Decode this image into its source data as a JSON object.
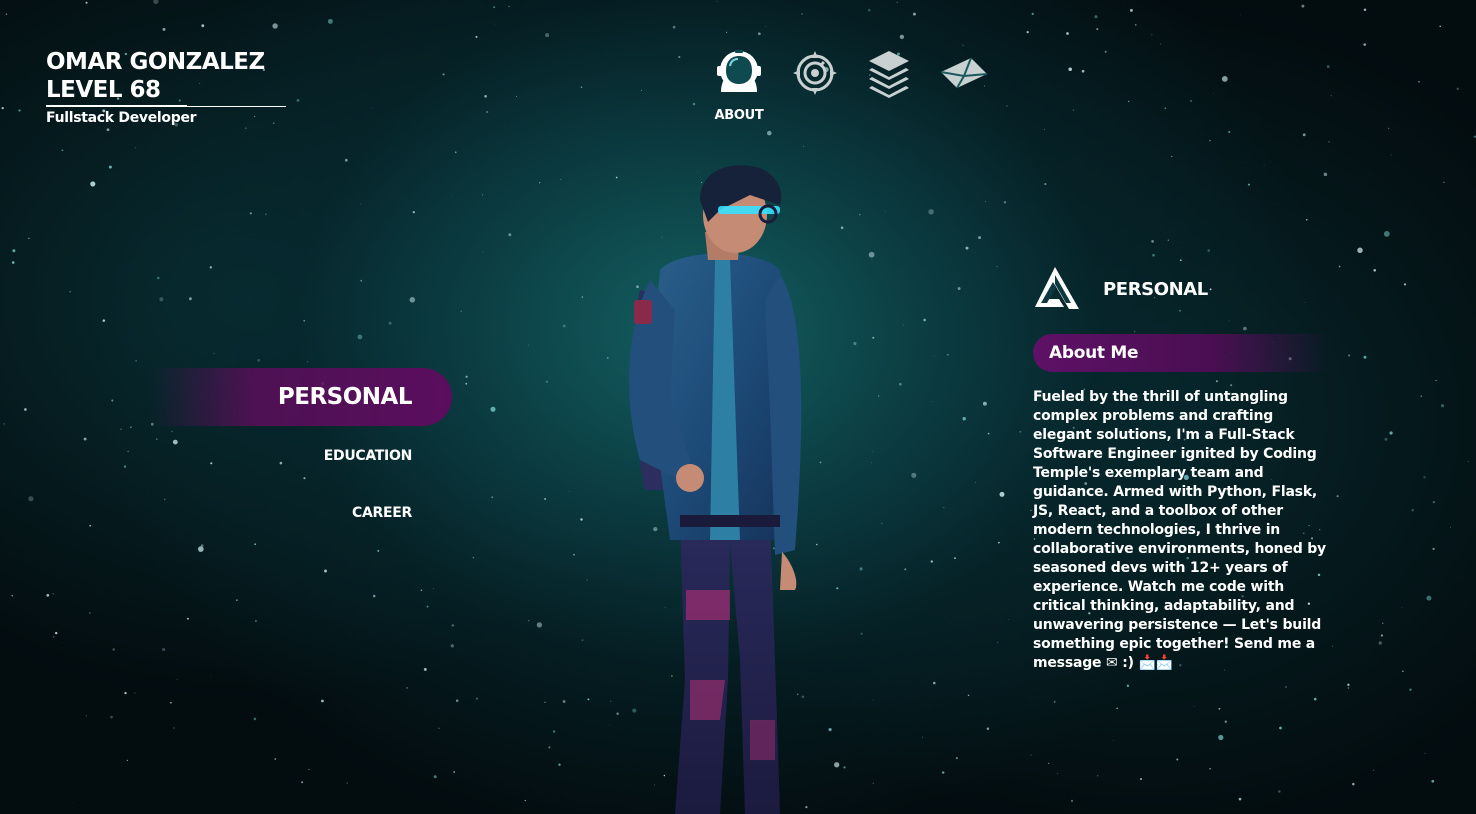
{
  "player": {
    "name": "OMAR GONZALEZ",
    "level": "LEVEL 68",
    "title": "Fullstack Developer"
  },
  "top_nav": {
    "items": [
      {
        "icon": "astronaut-helmet-icon",
        "label": "ABOUT",
        "active": true
      },
      {
        "icon": "target-compass-icon",
        "label": "",
        "active": false
      },
      {
        "icon": "layers-stack-icon",
        "label": "",
        "active": false
      },
      {
        "icon": "envelope-icon",
        "label": "",
        "active": false
      }
    ]
  },
  "side_menu": {
    "items": [
      {
        "label": "PERSONAL",
        "active": true
      },
      {
        "label": "EDUCATION",
        "active": false
      },
      {
        "label": "CAREER",
        "active": false
      }
    ]
  },
  "panel": {
    "section_title": "PERSONAL",
    "subheading": "About Me",
    "bio": "Fueled by the thrill of untangling complex problems and crafting elegant solutions, I'm a Full-Stack Software Engineer ignited by Coding Temple's exemplary team and guidance. Armed with Python, Flask, JS, React, and a toolbox of other modern technologies, I thrive in collaborative environments, honed by seasoned devs with 12+ years of experience. Watch me code with critical thinking, adaptability, and unwavering persistence — Let's build something epic together! Send me a message ✉ :) 📩📩"
  },
  "colors": {
    "accent_purple": "#5a0d5e",
    "background_teal": "#0e4e54",
    "text": "#ffffff"
  }
}
